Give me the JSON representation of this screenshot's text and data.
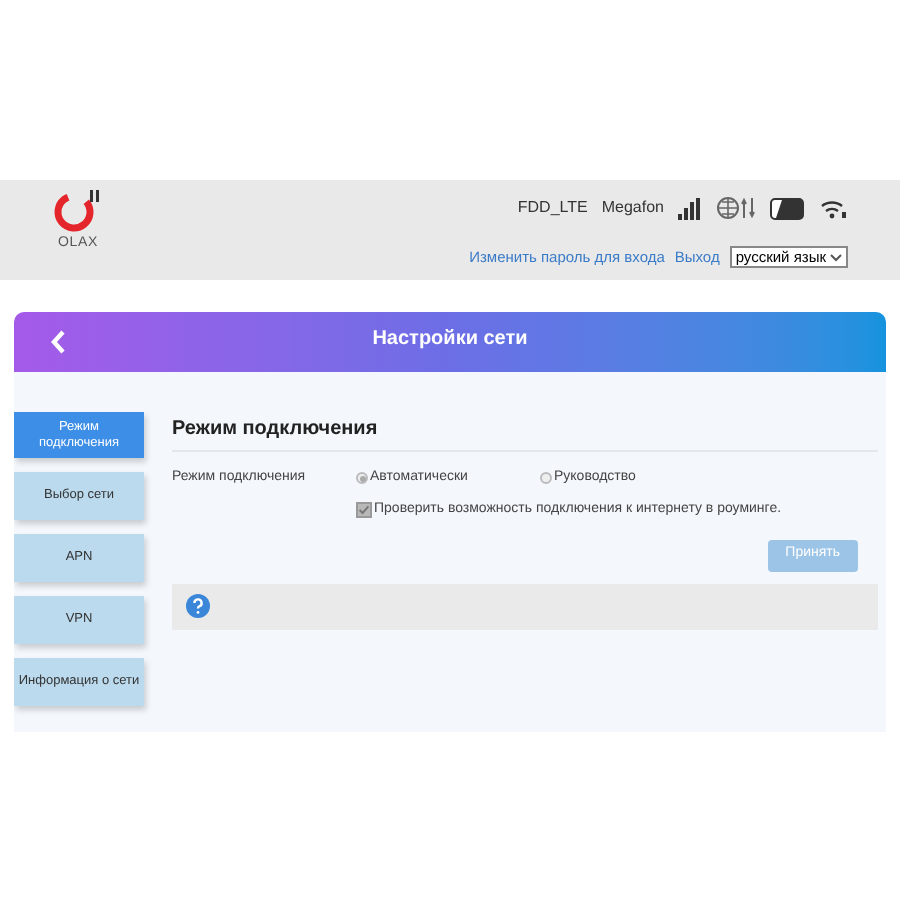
{
  "header": {
    "logo_text": "OLAX",
    "network_type": "FDD_LTE",
    "operator": "Megafon",
    "links": [
      "Изменить пароль для входа",
      "Выход"
    ],
    "language": "русский язык"
  },
  "title": "Настройки сети",
  "sidebar": [
    {
      "label": "Режим подключения",
      "selected": true
    },
    {
      "label": "Выбор сети",
      "selected": false
    },
    {
      "label": "APN",
      "selected": false
    },
    {
      "label": "VPN",
      "selected": false
    },
    {
      "label": "Информация о сети",
      "selected": false
    }
  ],
  "section_title": "Режим подключения",
  "field_label": "Режим подключения",
  "options": [
    {
      "label": "Автоматически",
      "selected": true
    },
    {
      "label": "Руководство",
      "selected": false
    }
  ],
  "roaming": {
    "label": "Проверить возможность подключения к интернету в роуминге.",
    "checked": true,
    "disabled": true
  },
  "apply": {
    "label": "Принять",
    "disabled": true
  }
}
